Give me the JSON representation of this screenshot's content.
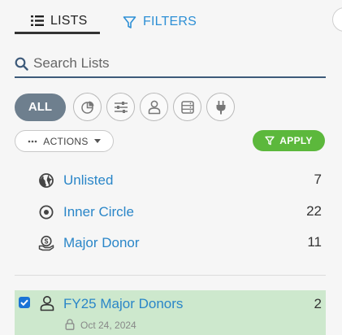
{
  "tabs": [
    {
      "label": "LISTS",
      "icon": "list-icon",
      "active": true
    },
    {
      "label": "FILTERS",
      "icon": "filter-icon",
      "active": false
    }
  ],
  "search": {
    "placeholder": "Search Lists",
    "value": ""
  },
  "type_filters": {
    "all_label": "ALL",
    "icons": [
      "pie-chart-icon",
      "sliders-icon",
      "user-icon",
      "database-icon",
      "plug-icon"
    ]
  },
  "actions": {
    "label": "ACTIONS",
    "icon": "ellipsis-icon"
  },
  "apply": {
    "label": "APPLY",
    "icon": "filter-icon",
    "color": "#5cb83c"
  },
  "system_lists": [
    {
      "label": "Unlisted",
      "count": "7",
      "icon": "globe-icon"
    },
    {
      "label": "Inner Circle",
      "count": "22",
      "icon": "target-circle-icon"
    },
    {
      "label": "Major Donor",
      "count": "11",
      "icon": "donor-hand-icon"
    }
  ],
  "saved_lists": [
    {
      "name": "FY25 Major Donors",
      "count": "2",
      "date": "Oct 24, 2024",
      "checked": true,
      "icon": "user-icon",
      "locked": true
    }
  ],
  "colors": {
    "link": "#2a86c8",
    "accent": "#2d8fd5",
    "selected_row": "#cde8cd",
    "all_button": "#6e7f8e"
  }
}
